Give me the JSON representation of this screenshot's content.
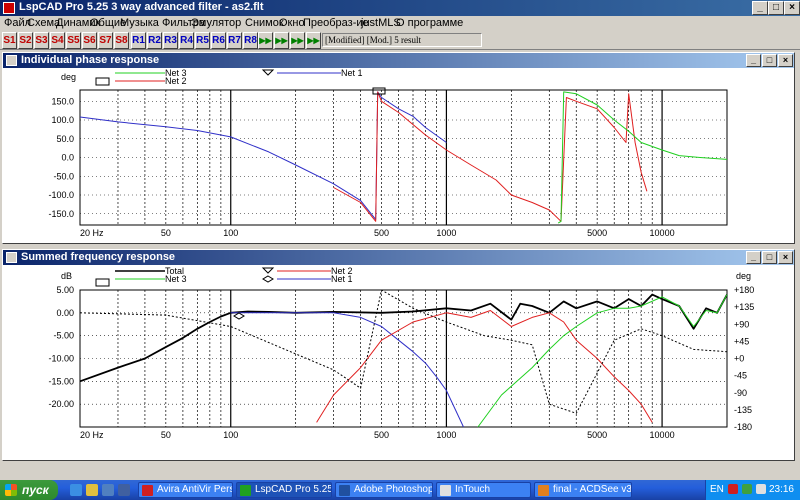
{
  "window": {
    "title": "LspCAD Pro 5.25 3 way advanced filter - as2.flt"
  },
  "menu": [
    "Файл",
    "Схема",
    "Динамик",
    "Общие",
    "Музыка Фильтра",
    "Эмулятор",
    "Снимок",
    "Окно",
    "Преобраз-ие",
    "justMLS",
    "О программе"
  ],
  "toolbar": {
    "s_buttons": [
      "S1",
      "S2",
      "S3",
      "S4",
      "S5",
      "S6",
      "S7",
      "S8"
    ],
    "r_buttons": [
      "R1",
      "R2",
      "R3",
      "R4",
      "R5",
      "R6",
      "R7",
      "R8"
    ],
    "status": "[Modified] [Mod.] 5 result"
  },
  "phase_window": {
    "title": "Individual phase response",
    "ylabel": "deg",
    "legend": [
      "Net 3",
      "Net 2",
      "Net 1"
    ],
    "colors": {
      "net1": "#3030c8",
      "net2": "#e02020",
      "net3": "#20d020"
    }
  },
  "freq_window": {
    "title": "Summed frequency response",
    "ylabel_left": "dB",
    "ylabel_right": "deg",
    "legend": [
      "Total",
      "Net 3",
      "Net 2",
      "Net 1"
    ],
    "colors": {
      "total": "#000000",
      "net1": "#3030c8",
      "net2": "#e02020",
      "net3": "#20d020"
    }
  },
  "chart_data": [
    {
      "type": "line",
      "title": "Individual phase response",
      "ylabel": "deg",
      "xscale": "log",
      "xlim": [
        20,
        20000
      ],
      "ylim": [
        -180,
        180
      ],
      "x_ticks": [
        "20 Hz",
        "50",
        "100",
        "500",
        "1000",
        "5000",
        "10000"
      ],
      "y_ticks": [
        "150.0",
        "100.0",
        "50.0",
        "0.0",
        "-50.0",
        "-100.0",
        "-150.0"
      ],
      "series": [
        {
          "name": "Net 1",
          "color": "#3030c8",
          "x": [
            20,
            30,
            50,
            70,
            100,
            150,
            200,
            300,
            400,
            470,
            480,
            500,
            600,
            700,
            800,
            1000
          ],
          "y": [
            108,
            95,
            82,
            72,
            55,
            15,
            -20,
            -70,
            -115,
            -165,
            175,
            160,
            130,
            110,
            80,
            40
          ]
        },
        {
          "name": "Net 2",
          "color": "#e02020",
          "x": [
            300,
            400,
            470,
            480,
            500,
            600,
            800,
            1000,
            1300,
            1700,
            2000,
            2500,
            3000,
            3400,
            3600,
            4000,
            5000,
            6000,
            6800,
            7000,
            7500,
            8000,
            8500
          ],
          "y": [
            -80,
            -120,
            -170,
            175,
            150,
            120,
            60,
            20,
            -20,
            -60,
            -100,
            -120,
            -140,
            -170,
            160,
            150,
            130,
            80,
            40,
            170,
            40,
            -40,
            -90
          ]
        },
        {
          "name": "Net 3",
          "color": "#20d020",
          "x": [
            3300,
            3400,
            3500,
            4000,
            5000,
            6000,
            7000,
            8000,
            10000,
            12000,
            15000,
            20000
          ],
          "y": [
            -175,
            -170,
            175,
            170,
            140,
            100,
            70,
            40,
            20,
            5,
            0,
            -5
          ]
        }
      ]
    },
    {
      "type": "line",
      "title": "Summed frequency response",
      "ylabel": "dB",
      "y2label": "deg",
      "xscale": "log",
      "xlim": [
        20,
        20000
      ],
      "ylim": [
        -25,
        5
      ],
      "y2lim": [
        -180,
        180
      ],
      "x_ticks": [
        "20 Hz",
        "50",
        "100",
        "500",
        "1000",
        "5000",
        "10000"
      ],
      "y_ticks": [
        "5.00",
        "0.00",
        "-5.00",
        "-10.00",
        "-15.00",
        "-20.00"
      ],
      "y2_ticks": [
        "+180",
        "+135",
        "+90",
        "+45",
        "+0",
        "-45",
        "-90",
        "-135",
        "-180"
      ],
      "series": [
        {
          "name": "Total",
          "color": "#000000",
          "x": [
            20,
            30,
            40,
            50,
            60,
            70,
            80,
            90,
            100,
            120,
            150,
            200,
            300,
            500,
            700,
            1000,
            1300,
            1600,
            2000,
            2200,
            2500,
            3000,
            3500,
            4000,
            5000,
            6000,
            7000,
            8000,
            9000,
            10000,
            12000,
            14000,
            16000,
            18000,
            20000
          ],
          "y": [
            -15.0,
            -12.0,
            -10.0,
            -7.5,
            -5.5,
            -3.5,
            -2.0,
            -0.8,
            0.0,
            0.3,
            0.2,
            0.0,
            0.2,
            0.0,
            0.3,
            1.0,
            0.5,
            2.0,
            -1.5,
            2.0,
            1.5,
            0.0,
            2.5,
            1.0,
            2.5,
            1.0,
            3.0,
            1.5,
            4.0,
            3.0,
            1.5,
            -3.5,
            1.0,
            0.0,
            4.0
          ]
        },
        {
          "name": "Net 1",
          "color": "#3030c8",
          "x": [
            100,
            200,
            300,
            400,
            500,
            600,
            700,
            800,
            900,
            1000,
            1200
          ],
          "y": [
            0.0,
            0.0,
            0.0,
            -1.0,
            -3.0,
            -6.0,
            -8.5,
            -11.0,
            -14.0,
            -17.0,
            -25.0
          ]
        },
        {
          "name": "Net 2",
          "color": "#e02020",
          "x": [
            250,
            300,
            400,
            500,
            700,
            1000,
            1300,
            1600,
            2000,
            2500,
            3000,
            3500,
            4000,
            5000,
            6000,
            7000,
            8000,
            9000
          ],
          "y": [
            -24.0,
            -18.0,
            -12.0,
            -6.0,
            -2.0,
            0.0,
            -1.0,
            0.5,
            -3.0,
            -1.0,
            0.0,
            -2.0,
            -6.0,
            -10.0,
            -14.0,
            -17.0,
            -20.0,
            -24.0
          ]
        },
        {
          "name": "Net 3",
          "color": "#20d020",
          "x": [
            1400,
            1800,
            2500,
            3000,
            3500,
            4000,
            5000,
            6000,
            7000,
            8000,
            10000,
            12000,
            14000,
            16000,
            18000,
            20000
          ],
          "y": [
            -25.0,
            -18.0,
            -12.0,
            -8.0,
            -5.0,
            -3.0,
            0.0,
            1.0,
            1.0,
            1.5,
            3.5,
            1.5,
            -3.0,
            0.5,
            0.0,
            4.0
          ]
        },
        {
          "name": "Net 1 phase (dashed)",
          "color": "#000000",
          "x": [
            20,
            50,
            100,
            200,
            300,
            400,
            500,
            700,
            1000,
            1500,
            2000,
            2500,
            3000,
            4000,
            6000,
            8000,
            10000,
            14000,
            20000
          ],
          "y": [
            0,
            -0.5,
            -3.0,
            -9.0,
            -12.5,
            -16.5,
            5.0,
            1.0,
            -2.0,
            -5.0,
            -6.0,
            -7.0,
            -20.0,
            -22.0,
            -6.0,
            -3.5,
            -5.0,
            -8.0,
            -8.5
          ]
        }
      ]
    }
  ],
  "taskbar": {
    "start": "пуск",
    "tasks": [
      "Avira AntiVir Personal...",
      "LspCAD Pro 5.25 3 w...",
      "Adobe Photoshop CS...",
      "InTouch",
      "final - ACDSee v3.1"
    ],
    "lang": "EN",
    "clock": "23:16"
  }
}
